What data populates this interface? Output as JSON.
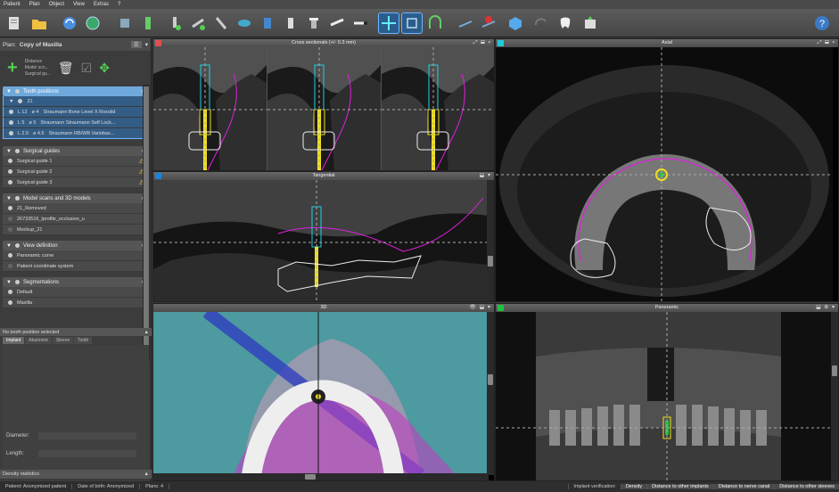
{
  "menu": [
    "Patient",
    "Plan",
    "Object",
    "View",
    "Extras",
    "?"
  ],
  "sidebar": {
    "plan_label": "Plan:",
    "plan_name": "Copy of Maxilla",
    "action_text": [
      "Distance",
      "Model scn...",
      "Surgical gu..."
    ],
    "tooth_positions": {
      "title": "Tooth positions",
      "tooth": "21",
      "implants": [
        {
          "length": "L 12",
          "diameter": "ø 4",
          "name": "Straumann Bone Level X Roxolid"
        },
        {
          "length": "L 5",
          "diameter": "ø 5",
          "name": "Straumann Straumann Self Lock..."
        },
        {
          "length": "L 2.5",
          "diameter": "ø 4.5",
          "name": "Straumann RB/WB Variobas..."
        }
      ]
    },
    "surgical_guides": {
      "title": "Surgical guides",
      "items": [
        "Surgical guide 1",
        "Surgical guide 2",
        "Surgical guide 3"
      ]
    },
    "model_scans": {
      "title": "Model scans and 3D models",
      "items": [
        "21_Removed",
        "26733516_lprofile_occlusion_u",
        "Mockup_21"
      ]
    },
    "view_definition": {
      "title": "View definition",
      "items": [
        "Panoramic curve",
        "Patient coordinate system"
      ]
    },
    "segmentations": {
      "title": "Segmentations",
      "items": [
        "Default",
        "Maxilla"
      ]
    },
    "no_selection": "No tooth position selected",
    "prop_tabs": [
      "Implant",
      "Abutment",
      "Sleeve",
      "Tooth"
    ],
    "diameter_label": "Diameter:",
    "length_label": "Length:",
    "density_stats": "Density statistics"
  },
  "views": {
    "cross": "Cross sectionals (+/- 0.3 mm)",
    "axial": "Axial",
    "tangential": "Tangential",
    "three_d": "3D",
    "panoramic": "Panoramic"
  },
  "status": {
    "patient": "Patient: Anonymized patient",
    "dob": "Date of birth: Anonymized",
    "plans": "Plans: 4",
    "implant_verification": "Implant verification:",
    "density": "Density",
    "dist_implants": "Distance to other implants",
    "dist_nerve": "Distance to nerve canal",
    "dist_sleeves": "Distance to other sleeves"
  },
  "colors": {
    "cross": "#e05050",
    "axial": "#20c8d8",
    "tangential": "#2080e0",
    "panoramic": "#20c040"
  }
}
